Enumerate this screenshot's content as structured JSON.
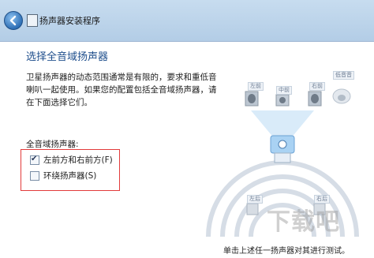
{
  "window": {
    "title": "扬声器安装程序"
  },
  "page": {
    "heading": "选择全音域扬声器",
    "description": "卫星扬声器的动态范围通常是有限的，要求和重低音喇叭一起使用。如果您的配置包括全音域扬声器，请在下面选择它们。",
    "group_label": "全音域扬声器:",
    "options": [
      {
        "label": "左前方和右前方(F)",
        "checked": true
      },
      {
        "label": "环绕扬声器(S)",
        "checked": false
      }
    ],
    "footer_hint": "单击上述任一扬声器对其进行测试。"
  },
  "speakers": {
    "front_left": "左前",
    "center": "中前",
    "front_right": "右前",
    "subwoofer": "低音音",
    "surround_left": "左后",
    "surround_right": "右后"
  },
  "watermark": "下载吧"
}
